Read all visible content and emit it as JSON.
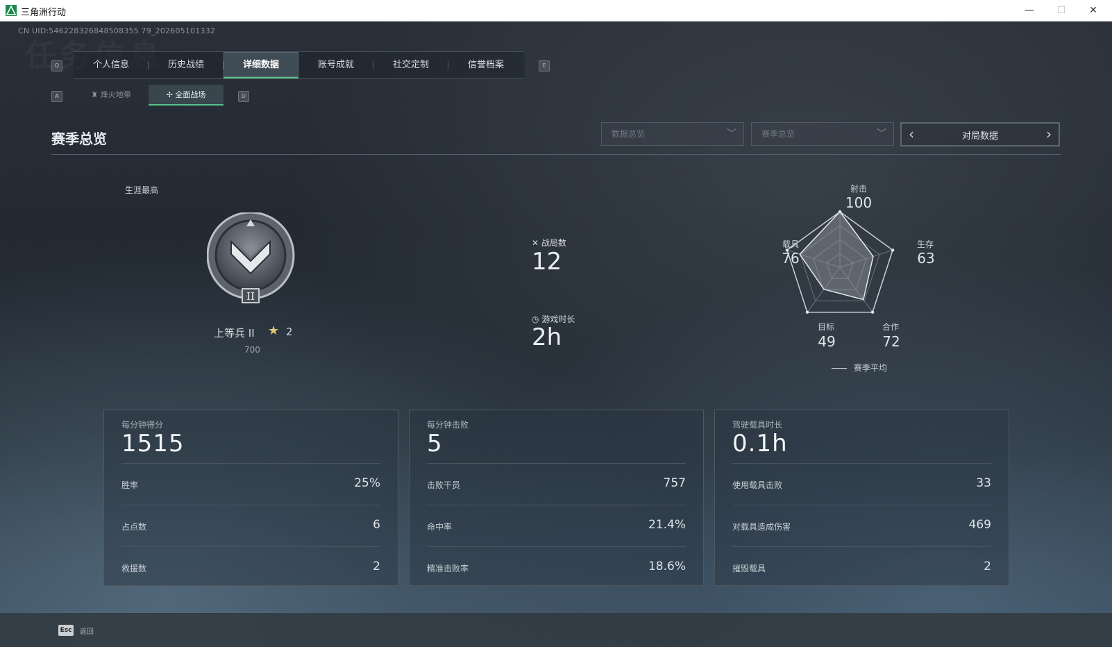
{
  "window": {
    "title": "三角洲行动",
    "minimize": "—",
    "maximize": "☐",
    "close": "✕"
  },
  "uid": "CN UID:546228326848508355 79_202605101332",
  "bg_text": "任务信息",
  "keyhints": {
    "prev_tab": "Q",
    "next_tab": "E",
    "prev_sub": "A",
    "next_sub": "D"
  },
  "tabs": [
    {
      "label": "个人信息"
    },
    {
      "label": "历史战绩"
    },
    {
      "label": "详细数据"
    },
    {
      "label": "账号成就"
    },
    {
      "label": "社交定制"
    },
    {
      "label": "信誉档案"
    }
  ],
  "subtabs": [
    {
      "label": "烽火地带",
      "icon": "tower-icon"
    },
    {
      "label": "全面战场",
      "icon": "crosshair-icon"
    }
  ],
  "section": {
    "title": "赛季总览"
  },
  "filters": {
    "data_overview": "数据总览",
    "season_overview": "赛季总览",
    "pager_label": "对局数据"
  },
  "career": {
    "label": "生涯最高",
    "rank_name": "上等兵 II",
    "stars": "2",
    "points": "700"
  },
  "center_stats": {
    "matches_label": "战局数",
    "matches_value": "12",
    "playtime_label": "游戏时长",
    "playtime_value": "2h"
  },
  "radar": {
    "axes": [
      {
        "label": "射击",
        "value": "100"
      },
      {
        "label": "生存",
        "value": "63"
      },
      {
        "label": "合作",
        "value": "72"
      },
      {
        "label": "目标",
        "value": "49"
      },
      {
        "label": "载具",
        "value": "76"
      }
    ],
    "values": [
      100,
      63,
      72,
      49,
      76
    ],
    "legend": "赛季平均"
  },
  "cards": [
    {
      "head_label": "每分钟得分",
      "head_value": "1515",
      "rows": [
        {
          "k": "胜率",
          "v": "25%"
        },
        {
          "k": "占点数",
          "v": "6"
        },
        {
          "k": "救援数",
          "v": "2"
        }
      ]
    },
    {
      "head_label": "每分钟击败",
      "head_value": "5",
      "rows": [
        {
          "k": "击败干员",
          "v": "757"
        },
        {
          "k": "命中率",
          "v": "21.4%"
        },
        {
          "k": "精准击败率",
          "v": "18.6%"
        }
      ]
    },
    {
      "head_label": "驾驶载具时长",
      "head_value": "0.1h",
      "rows": [
        {
          "k": "使用载具击败",
          "v": "33"
        },
        {
          "k": "对载具造成伤害",
          "v": "469"
        },
        {
          "k": "摧毁载具",
          "v": "2"
        }
      ]
    }
  ],
  "footer": {
    "esc_key": "Esc",
    "esc_label": "返回"
  },
  "colors": {
    "accent_green": "#58c08a",
    "rank_star": "#e6c67a"
  }
}
